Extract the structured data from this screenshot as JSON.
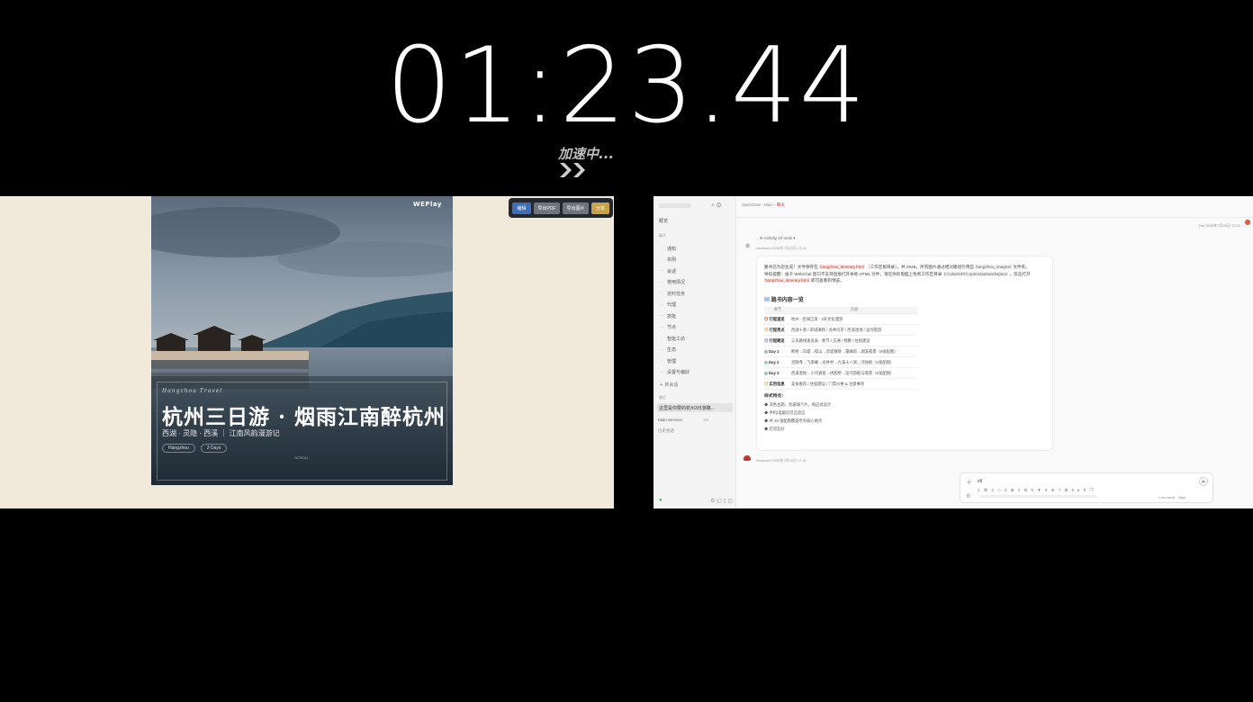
{
  "overlay": {
    "timer": "01:23.44",
    "speed_label": "加速中..."
  },
  "travel": {
    "toolbar": {
      "edit": "编辑",
      "export_pdf": "导出PDF",
      "export_image": "导出图片",
      "share": "分享"
    },
    "poster": {
      "logo": "WEPlay",
      "kicker": "Hangzhou Travel",
      "title": "杭州三日游 · 烟雨江南醉杭州",
      "subtitle": "西湖 · 灵隐 · 西溪 ｜ 江南风韵漫游记",
      "tags": [
        "Hangzhou",
        "3 Days"
      ],
      "scroll_hint": "SCROLL"
    }
  },
  "chat": {
    "sidebar": {
      "overview": "概览",
      "section_main": "聊天",
      "items": [
        {
          "icon": "·",
          "label": "通知"
        },
        {
          "icon": "·",
          "label": "实例"
        },
        {
          "icon": "·",
          "label": "会话"
        },
        {
          "icon": "·",
          "label": "使用情况"
        },
        {
          "icon": "·",
          "label": "定时任务"
        },
        {
          "icon": "·",
          "label": "代理"
        },
        {
          "icon": "·",
          "label": "技能"
        },
        {
          "icon": "·",
          "label": "节点"
        },
        {
          "icon": "·",
          "label": "智能工坊"
        },
        {
          "icon": "·",
          "label": "生态"
        },
        {
          "icon": "·",
          "label": "管理"
        },
        {
          "icon": "·",
          "label": "设置与偏好"
        }
      ],
      "new_chat": "新会话",
      "section_recent": "最近",
      "active_session": "这里是你要的杭州3日游路...",
      "main_session": "Main Session",
      "main_session_count": "3/4",
      "history": "历史会话"
    },
    "breadcrumb": {
      "a": "OpenClaw",
      "b": "Main",
      "c": "聊天"
    },
    "you_line": "You  2026年7月20日 17:41",
    "activity": "Activity  10 tools",
    "assistant_line": "Assistant  2026年7月20日 17:41",
    "message": {
      "p1_a": "路书已为您生成！文件保存在",
      "p1_code": "hangzhou_itinerary.html",
      "p1_b": "（工作区根目录），共 254B，所有图片通过相对路径引用自",
      "p1_code2": "hangzhou_images/",
      "p1_c": "文件夹。",
      "p2_a": "导航提醒：由于 WebChat 窗口不支持直接打开本地 HTML 文件，请在你的电脑上找到工作区目录",
      "p2_code": "C:\\Users\\PC\\.openclaw\\workspace",
      "p2_b": "，双击打开",
      "p2_code2": "hangzhou_itinerary.html",
      "p2_c": "即可查看和预览。",
      "table_title": "路书内容一览",
      "table_headers": [
        "章节",
        "内容"
      ],
      "table_rows": [
        {
          "icon": "◎",
          "key": "行程速览",
          "value": "杭州 · 西湖江南 · 3天文化漫游"
        },
        {
          "icon": "◎",
          "key": "行程亮点",
          "value": "西湖十景 / 宋城演绎 / 龙井问茶 / 西溪湿地 / 运河夜游"
        },
        {
          "icon": "◎",
          "key": "行程概览",
          "value": "三天路线速览表 · 季节 / 交通 / 预算 / 住宿建议"
        },
        {
          "icon": "◎",
          "key": "Day 1",
          "value": "断桥→白堤→孤山→苏堤春晓→雷峰塔→湖滨夜景（6张配图）"
        },
        {
          "icon": "◎",
          "key": "Day 2",
          "value": "灵隐寺→飞来峰→龙井村→九溪十八涧→河坊街（6张配图）"
        },
        {
          "icon": "◎",
          "key": "Day 3",
          "value": "西溪湿地→小河直街→拱宸桥→运河游船与夜景（6张配图）"
        },
        {
          "icon": "◎",
          "key": "实用信息",
          "value": "美食推荐 / 住宿建议 / 门票价格 & 注意事项"
        }
      ],
      "style_title": "样式特点：",
      "bullets": [
        "◆ 深色主题，毛玻璃卡片，响应式设计",
        "◆ 手机/电脑均可自适应",
        "◆ 共 18 张配图覆盖所有核心地点",
        "◆ 打印友好"
      ]
    },
    "assistant2": "Assistant  2026年7月20日 17:41",
    "composer": {
      "text": "ctl",
      "hints": "1 ⌘   2 ◇   3 ⊞   4 ⊟   5 ▼   6 ⊕   7 ⊞   8 ▸   9 ❐",
      "model": "Low  Level · High"
    }
  }
}
